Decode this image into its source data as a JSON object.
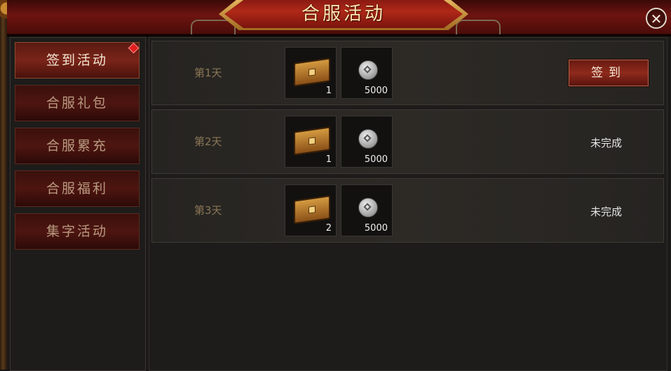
{
  "title": "合服活动",
  "close_icon": "close-icon",
  "sidebar": {
    "items": [
      {
        "label": "签到活动",
        "active": true,
        "badge": true
      },
      {
        "label": "合服礼包"
      },
      {
        "label": "合服累充"
      },
      {
        "label": "合服福利"
      },
      {
        "label": "集字活动"
      }
    ]
  },
  "rows": [
    {
      "day": "第1天",
      "rewards": [
        {
          "icon": "treasure-chest-icon",
          "count": "1"
        },
        {
          "icon": "silver-coin-icon",
          "count": "5000"
        }
      ],
      "action": "签到",
      "action_type": "button"
    },
    {
      "day": "第2天",
      "rewards": [
        {
          "icon": "treasure-chest-icon",
          "count": "1"
        },
        {
          "icon": "silver-coin-icon",
          "count": "5000"
        }
      ],
      "action": "未完成",
      "action_type": "status"
    },
    {
      "day": "第3天",
      "rewards": [
        {
          "icon": "treasure-chest-icon",
          "count": "2"
        },
        {
          "icon": "silver-coin-icon",
          "count": "5000"
        }
      ],
      "action": "未完成",
      "action_type": "status"
    }
  ],
  "colors": {
    "accent": "#8e2a1c",
    "gold": "#fde7b0",
    "badge": "#e02020"
  }
}
